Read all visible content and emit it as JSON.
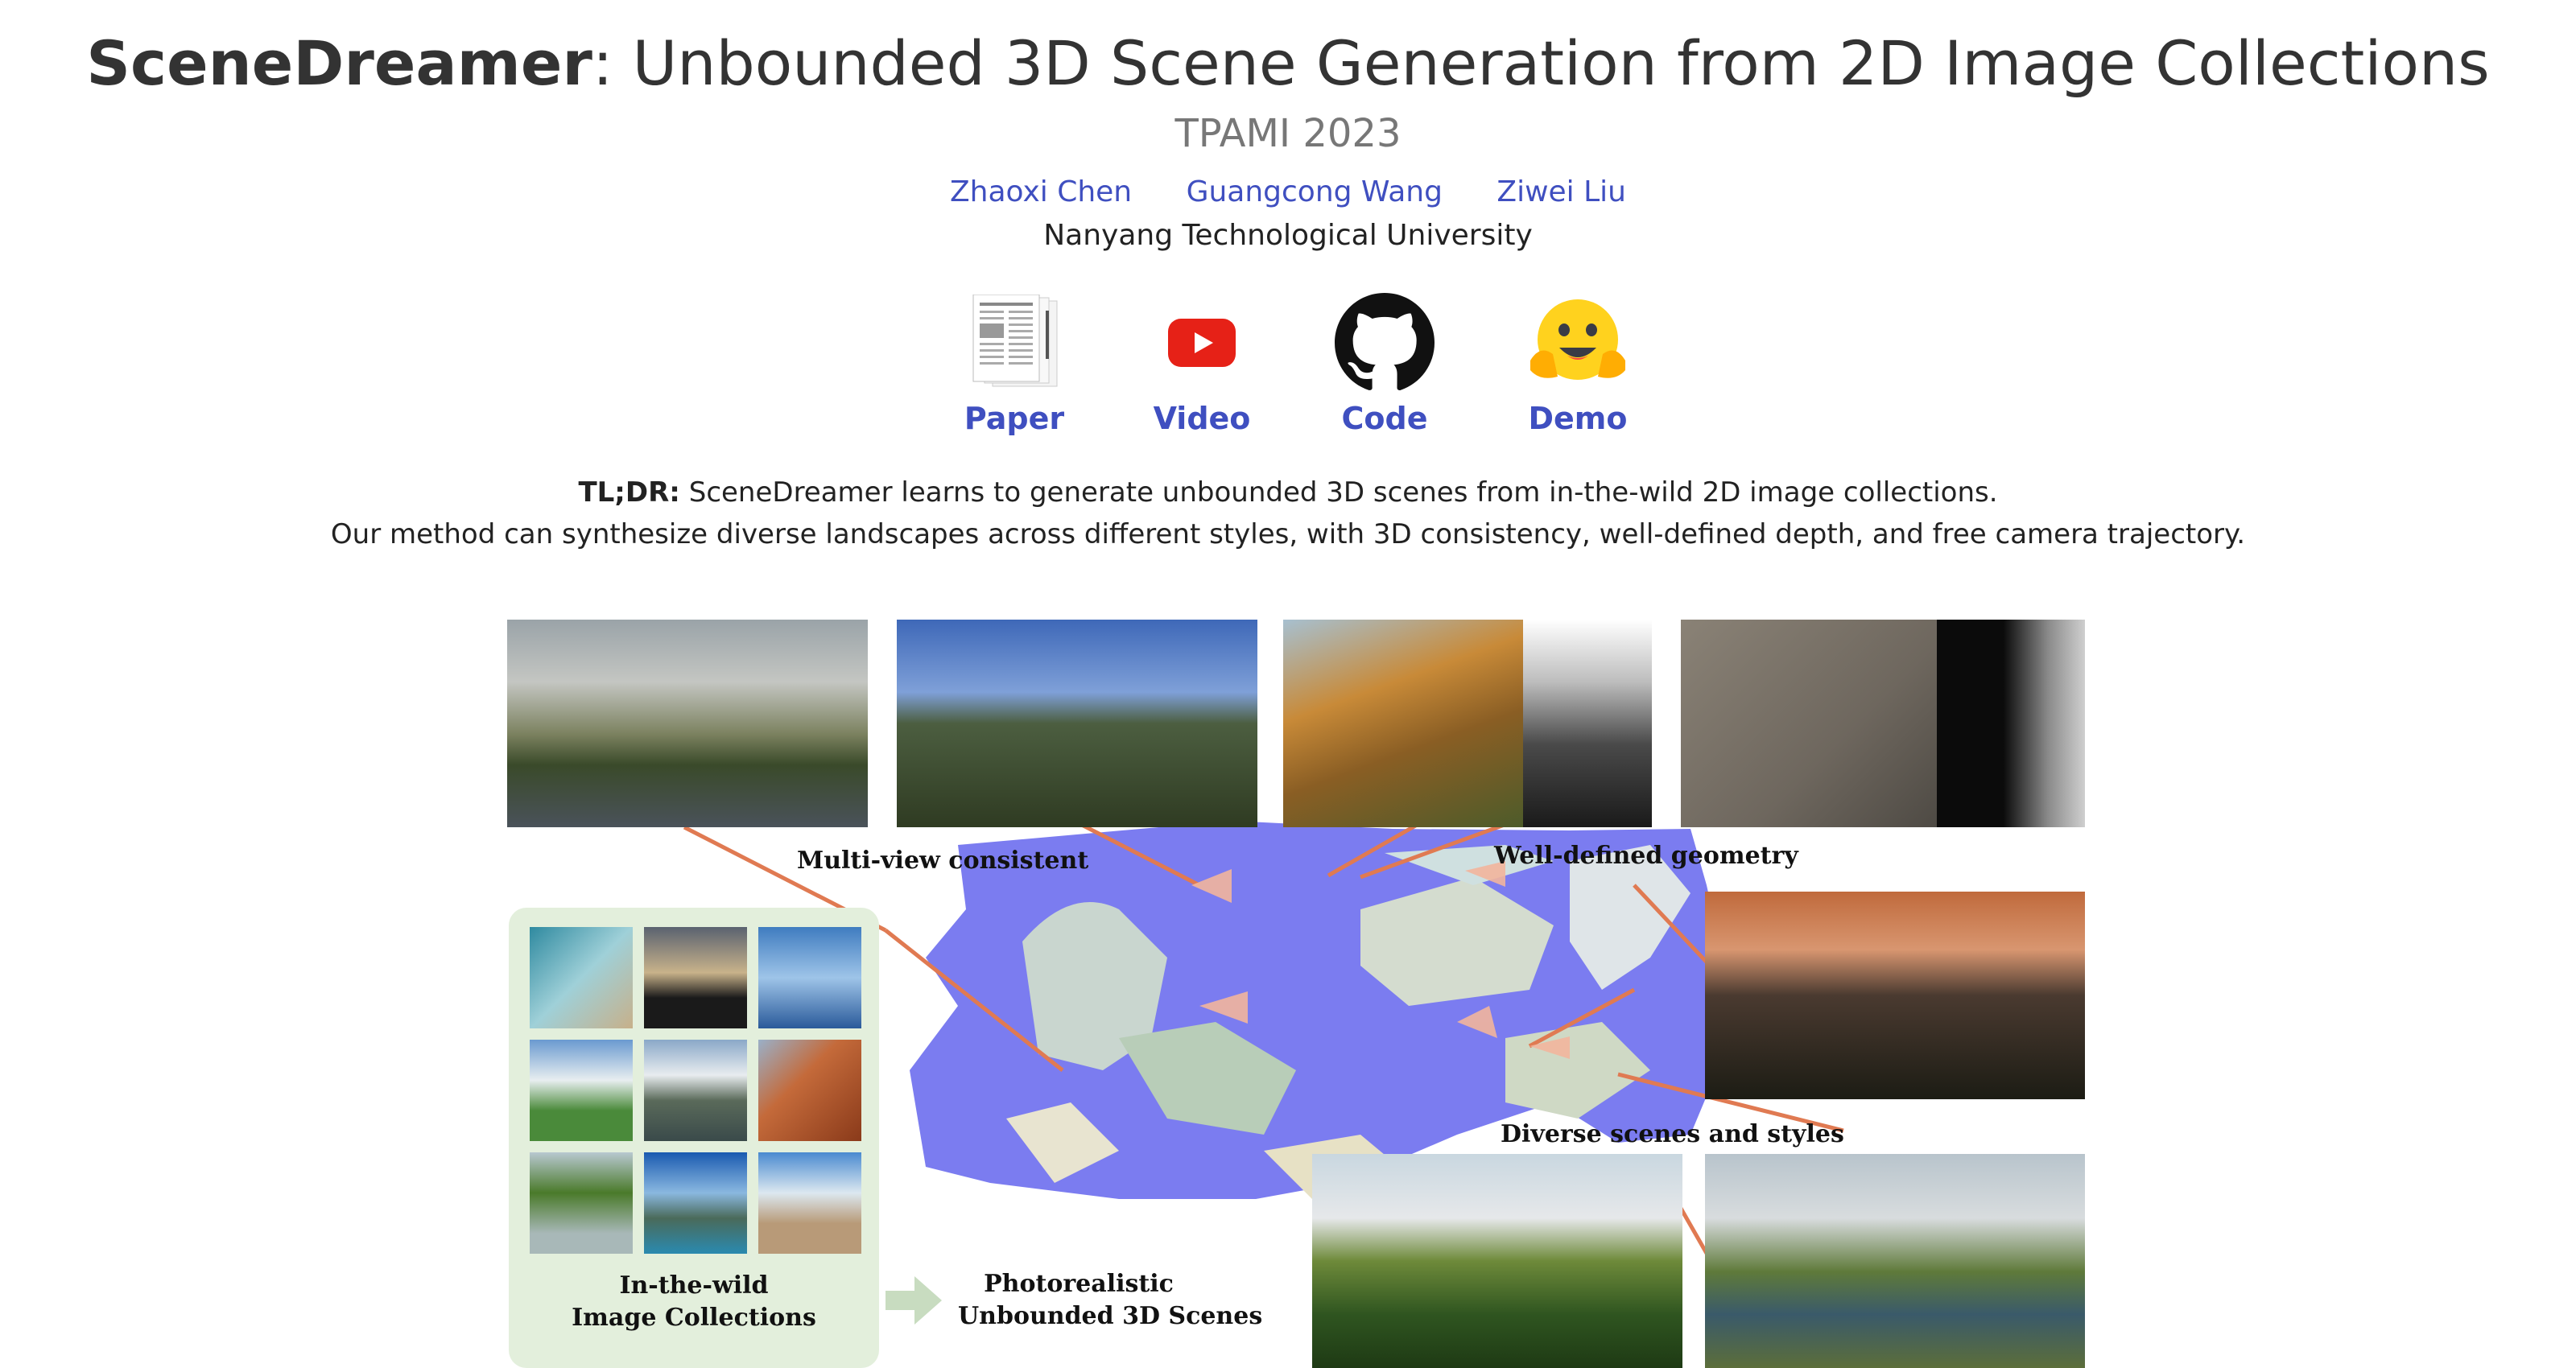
{
  "header": {
    "title_bold": "SceneDreamer",
    "title_rest": ": Unbounded 3D Scene Generation from 2D Image Collections",
    "venue": "TPAMI 2023",
    "authors": [
      "Zhaoxi Chen",
      "Guangcong Wang",
      "Ziwei Liu"
    ],
    "affiliation": "Nanyang Technological University"
  },
  "links": [
    {
      "label": "Paper",
      "icon": "paper-icon"
    },
    {
      "label": "Video",
      "icon": "youtube-icon"
    },
    {
      "label": "Code",
      "icon": "github-icon"
    },
    {
      "label": "Demo",
      "icon": "huggingface-icon"
    }
  ],
  "tldr": {
    "prefix": "TL;DR:",
    "line1": "SceneDreamer learns to generate unbounded 3D scenes from in-the-wild 2D image collections.",
    "line2": "Our method can synthesize diverse landscapes across different styles, with 3D consistency, well-defined depth, and free camera trajectory."
  },
  "figure": {
    "label_multiview": "Multi-view consistent",
    "label_geometry": "Well-defined geometry",
    "label_diverse": "Diverse scenes and styles",
    "label_collections_1": "In-the-wild",
    "label_collections_2": "Image Collections",
    "label_scenes_1": "Photorealistic",
    "label_scenes_2": "Unbounded 3D Scenes"
  },
  "colors": {
    "link": "#3f4fc0",
    "accent_orange": "#e07a52",
    "water": "#7b7cf0",
    "panel_green": "#e3efdc"
  }
}
